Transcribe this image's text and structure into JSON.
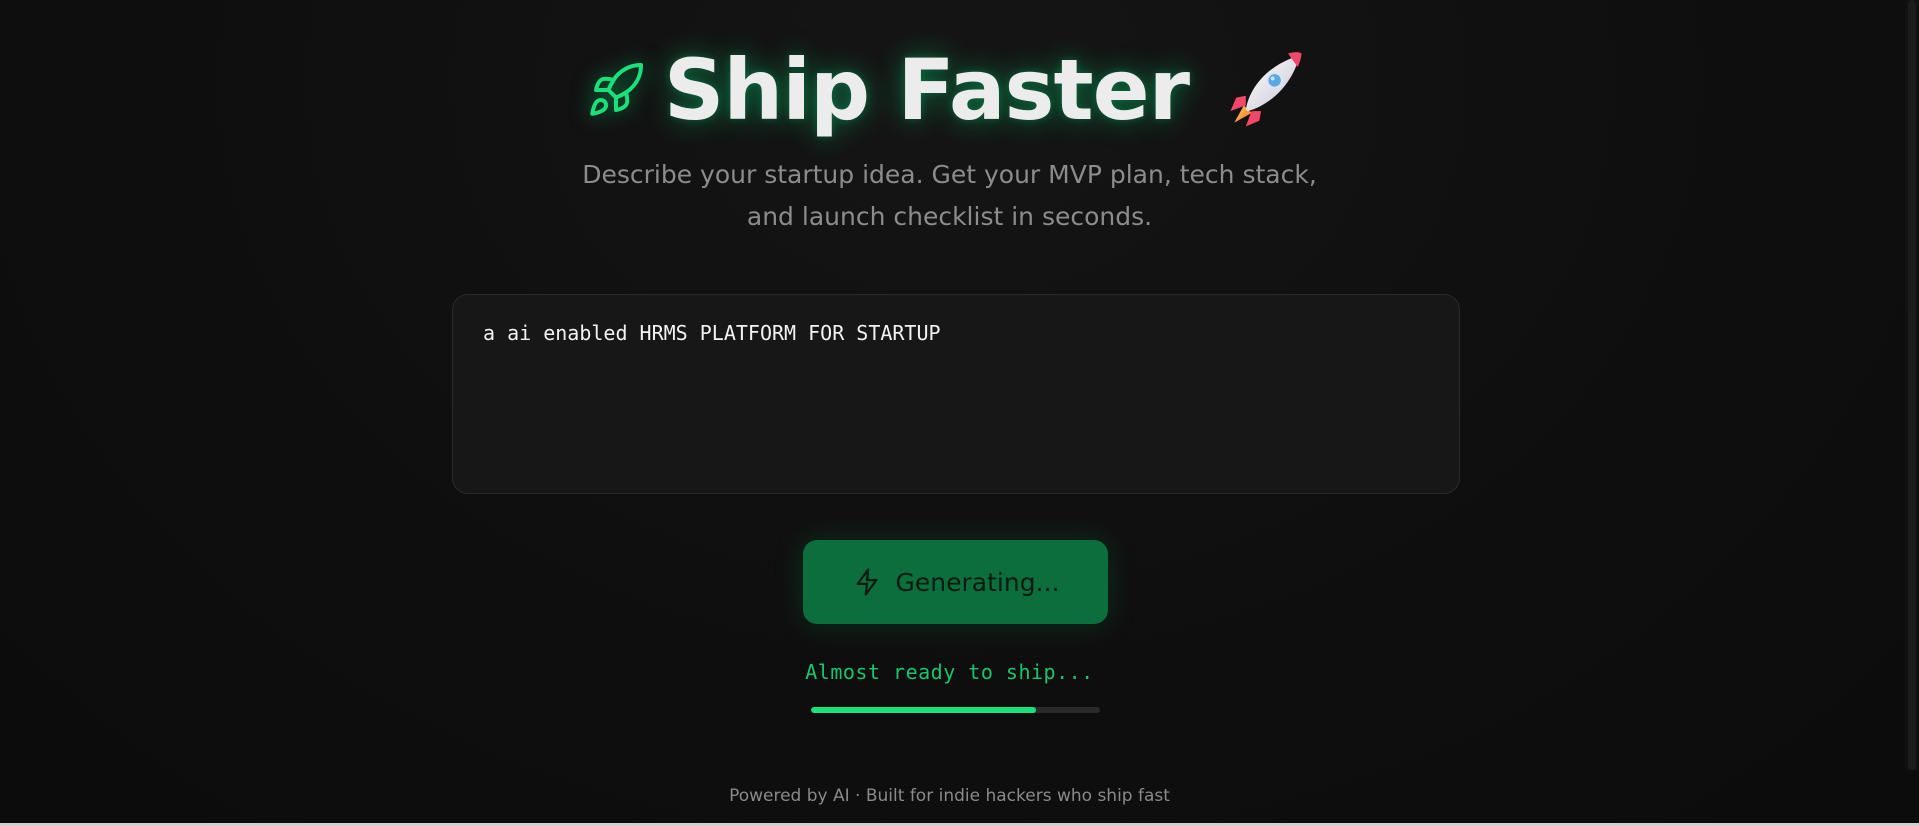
{
  "header": {
    "title": "Ship Faster",
    "leading_icon": "rocket-outline-icon",
    "trailing_icon": "rocket-emoji-icon",
    "subtitle_line1": "Describe your startup idea. Get your MVP plan, tech stack,",
    "subtitle_line2": "and launch checklist in seconds."
  },
  "idea_input": {
    "value": "a ai enabled HRMS PLATFORM FOR STARTUP"
  },
  "generate_button": {
    "label": "Generating...",
    "icon": "bolt-icon",
    "state": "loading"
  },
  "status": {
    "text": "Almost ready to ship...",
    "progress": 0.78
  },
  "footer": {
    "text": "Powered by AI · Built for indie hackers who ship fast"
  },
  "colors": {
    "background": "#0e0e0e",
    "accent": "#17e37c",
    "button_bg": "#0c6e3c",
    "status_text": "#18c46c"
  }
}
